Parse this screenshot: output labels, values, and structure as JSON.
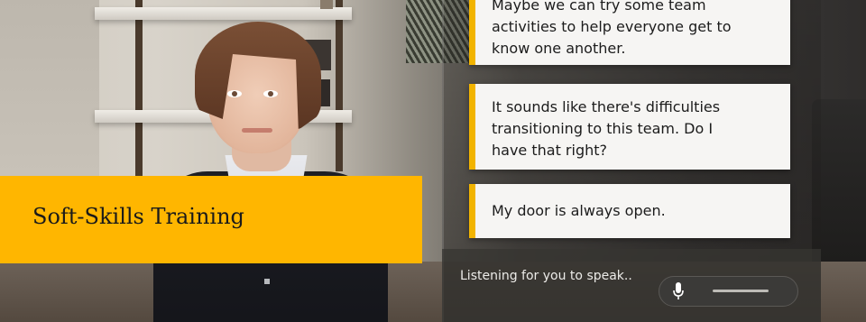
{
  "banner": {
    "title": "Soft-Skills Training",
    "color": "#ffb600"
  },
  "dialogue": {
    "options": [
      {
        "lines": [
          "Maybe we can try some team",
          "activities to help everyone get to",
          "know one another."
        ]
      },
      {
        "lines": [
          "It sounds like there's difficulties",
          "transitioning to this team. Do I",
          "have that right?"
        ]
      },
      {
        "lines": [
          "My door is always open."
        ]
      }
    ],
    "accent_color": "#f2b400"
  },
  "voice": {
    "status": "Listening for you to speak..",
    "icon": "microphone-icon"
  }
}
